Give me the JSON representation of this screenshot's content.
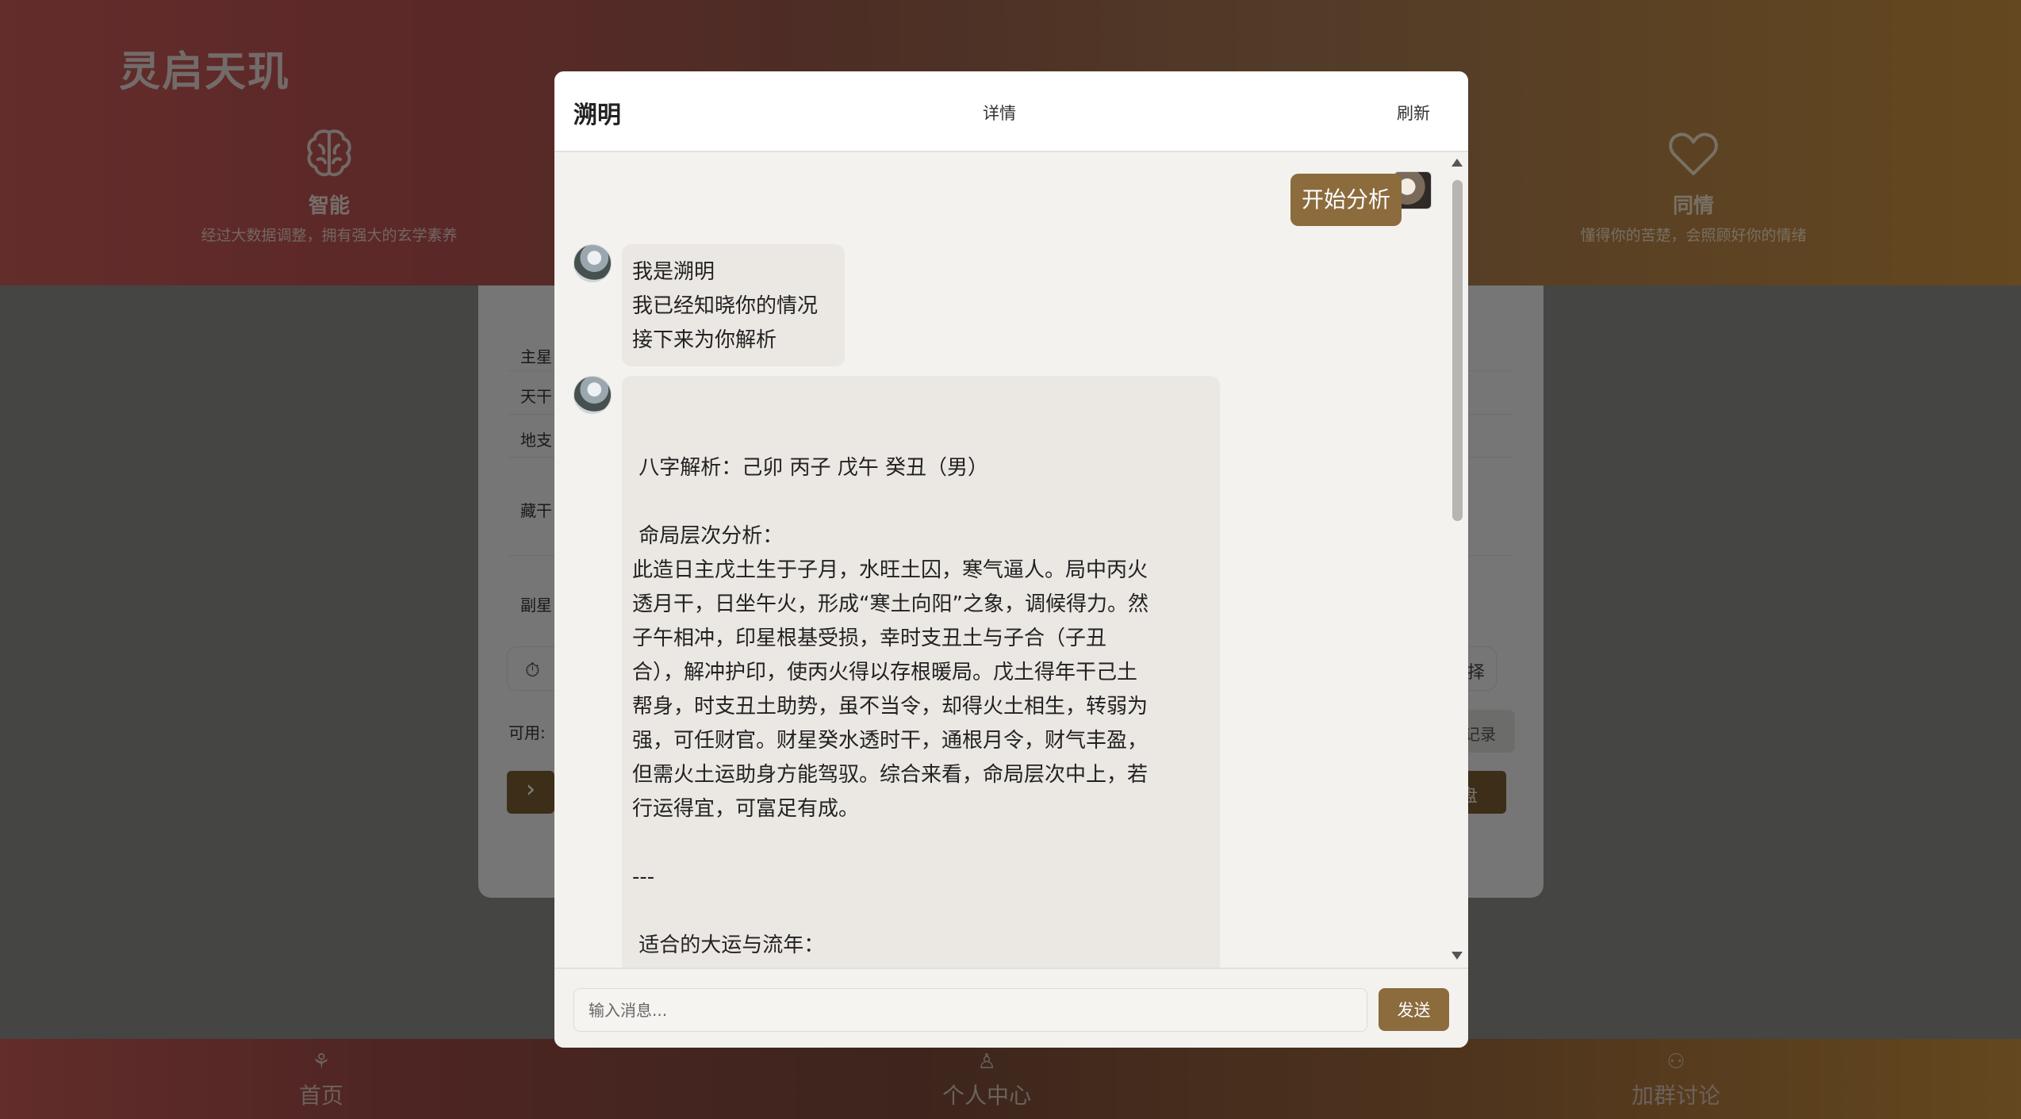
{
  "colors": {
    "accent": "#8c6b3d",
    "hero_left": "#c55a55",
    "hero_right": "#c8903e"
  },
  "app": {
    "brand": "灵启天玑"
  },
  "features": [
    {
      "icon": "brain-icon",
      "title": "智能",
      "desc": "经过大数据调整，拥有强大的玄学素养"
    },
    {
      "icon": "heart-icon",
      "title": "同情",
      "desc": "懂得你的苦楚，会照顾好你的情绪"
    }
  ],
  "panel": {
    "rows": [
      "主星",
      "天干",
      "地支",
      "藏干",
      "副星"
    ],
    "available_label": "可用:",
    "record_button": "记录",
    "tool_right": "择",
    "chart_button": "盘"
  },
  "bottom_nav": [
    {
      "icon": "home-icon",
      "label": "首页"
    },
    {
      "icon": "user-icon",
      "label": "个人中心"
    },
    {
      "icon": "group-icon",
      "label": "加群讨论"
    }
  ],
  "chat": {
    "title": "溯明",
    "detail_label": "详情",
    "refresh_label": "刷新",
    "user_message": "开始分析",
    "bot_intro": [
      "我是溯明",
      "我已经知晓你的情况",
      "接下来为你解析"
    ],
    "analysis_lines": [
      " 八字解析：己卯 丙子 戊午 癸丑（男）",
      "",
      " 命局层次分析：",
      "此造日主戊土生于子月，水旺土囚，寒气逼人。局中丙火",
      "透月干，日坐午火，形成“寒土向阳”之象，调候得力。然",
      "子午相冲，印星根基受损，幸时支丑土与子合（子丑",
      "合），解冲护印，使丙火得以存根暖局。戊土得年干己土",
      "帮身，时支丑土助势，虽不当令，却得火土相生，转弱为",
      "强，可任财官。财星癸水透时干，通根月令，财气丰盈，",
      "但需火土运助身方能驾驭。综合来看，命局层次中上，若",
      "行运得宜，可富足有成。",
      "",
      "---",
      "",
      " 适合的大运与流年："
    ],
    "input_placeholder": "输入消息...",
    "send_label": "发送"
  }
}
